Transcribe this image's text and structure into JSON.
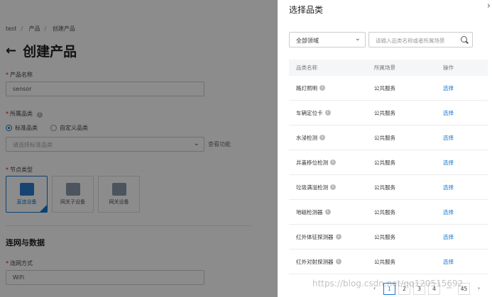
{
  "background": {
    "breadcrumb": [
      "test",
      "产品",
      "创建产品"
    ],
    "title": "创建产品",
    "product_name_label": "产品名称",
    "product_name_value": "sensor",
    "category_label": "所属品类",
    "radio_standard": "标准品类",
    "radio_custom": "自定义品类",
    "category_placeholder": "请选择标准品类",
    "view_function": "查看功能",
    "node_type_label": "节点类型",
    "nodes": [
      "直连设备",
      "网关子设备",
      "网关设备"
    ],
    "section_title": "连网与数据",
    "network_label": "连网方式",
    "network_value": "WiFi"
  },
  "drawer": {
    "title": "选择品类",
    "domain_value": "全部领域",
    "search_placeholder": "请输入品类名称或者所属场景",
    "columns": [
      "品类名称",
      "所属场景",
      "操作"
    ],
    "rows": [
      {
        "name": "路灯照明",
        "scene": "公共服务",
        "action": "选择"
      },
      {
        "name": "车辆定位卡",
        "scene": "公共服务",
        "action": "选择"
      },
      {
        "name": "水浸检测",
        "scene": "公共服务",
        "action": "选择"
      },
      {
        "name": "井盖移位检测",
        "scene": "公共服务",
        "action": "选择"
      },
      {
        "name": "垃圾满溢检测",
        "scene": "公共服务",
        "action": "选择"
      },
      {
        "name": "地磁检测器",
        "scene": "公共服务",
        "action": "选择"
      },
      {
        "name": "红外体征探测器",
        "scene": "公共服务",
        "action": "选择"
      },
      {
        "name": "红外对射探测器",
        "scene": "公共服务",
        "action": "选择"
      }
    ],
    "pagination": [
      "1",
      "2",
      "3",
      "4",
      "···",
      "45"
    ]
  },
  "watermark": "https://blog.csdn.net/qq120515692",
  "colors": {
    "accent": "#1677d2",
    "overlay": "rgba(0,0,0,0.45)"
  }
}
